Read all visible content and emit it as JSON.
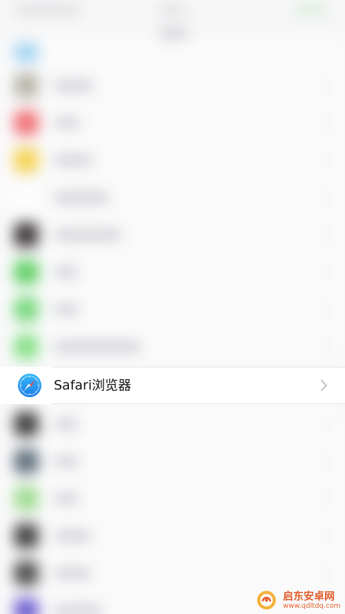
{
  "focused_row": {
    "label": "Safari浏览器",
    "icon": "safari-compass-icon"
  },
  "watermark": {
    "name": "启东安卓网",
    "url": "www.qdltdq.com"
  },
  "colors": {
    "safari_blue": "#1f8ff0",
    "chevron_gray": "#c4c4c7",
    "watermark_orange": "#e35d2a"
  }
}
